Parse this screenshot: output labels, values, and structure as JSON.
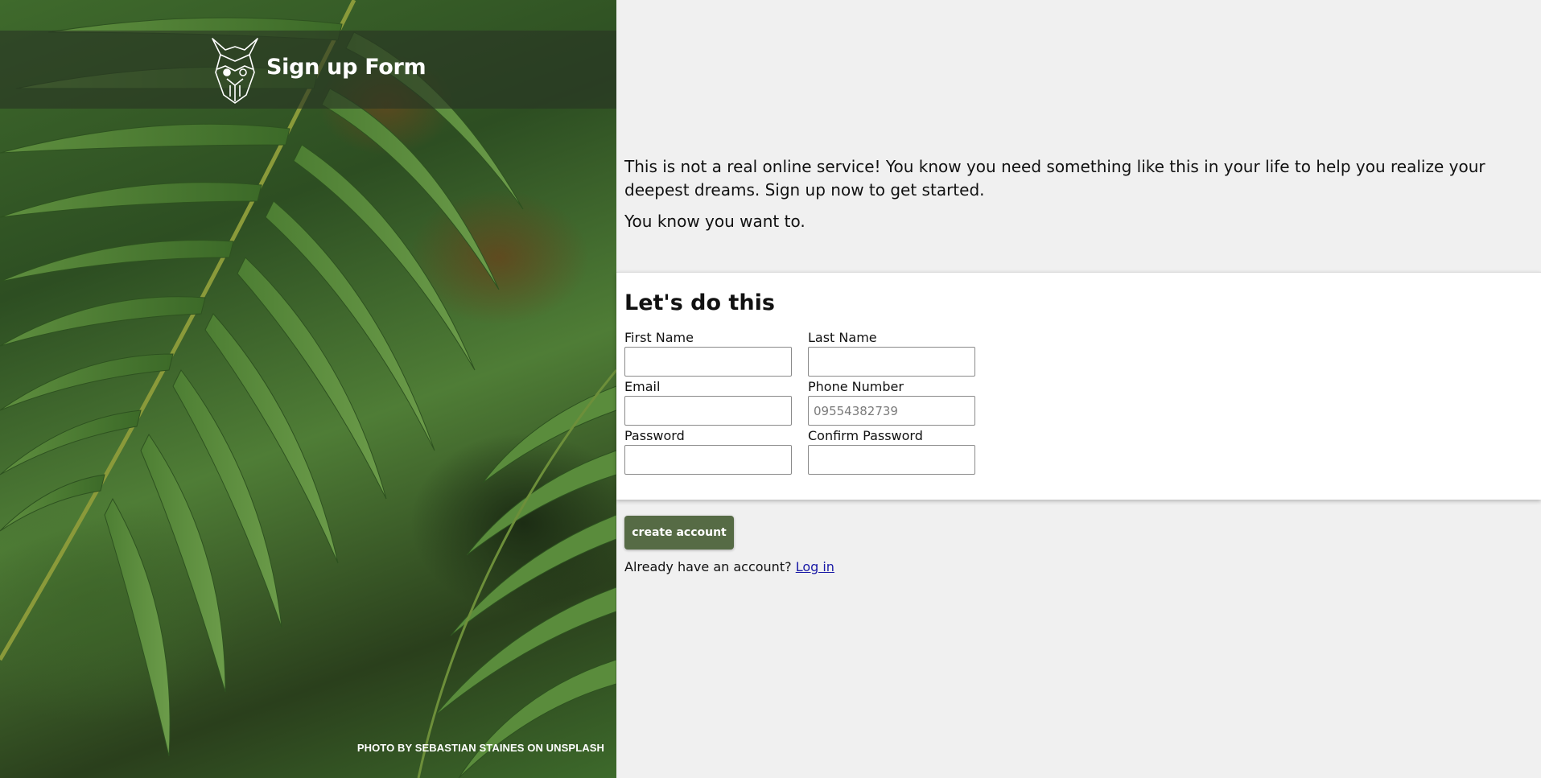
{
  "hero": {
    "title": "Sign up Form",
    "logo_icon": "odin-helmet-logo-icon",
    "credit": "PHOTO BY SEBASTIAN STAINES ON UNSPLASH"
  },
  "intro": {
    "paragraph_1": "This is not a real online service! You know you need something like this in your life to help you realize your deepest dreams. Sign up now to get started.",
    "paragraph_2": "You know you want to."
  },
  "form": {
    "heading": "Let's do this",
    "first_name": {
      "label": "First Name",
      "value": "",
      "placeholder": ""
    },
    "last_name": {
      "label": "Last Name",
      "value": "",
      "placeholder": ""
    },
    "email": {
      "label": "Email",
      "value": "",
      "placeholder": ""
    },
    "phone": {
      "label": "Phone Number",
      "value": "",
      "placeholder": "09554382739"
    },
    "password": {
      "label": "Password",
      "value": "",
      "placeholder": ""
    },
    "confirm_password": {
      "label": "Confirm Password",
      "value": "",
      "placeholder": ""
    }
  },
  "actions": {
    "create_label": "create account",
    "login_prompt": "Already have an account?",
    "login_link": "Log in"
  },
  "colors": {
    "button_bg": "#566b45",
    "page_bg": "#f0f0f0",
    "link": "#1a1aa6"
  }
}
